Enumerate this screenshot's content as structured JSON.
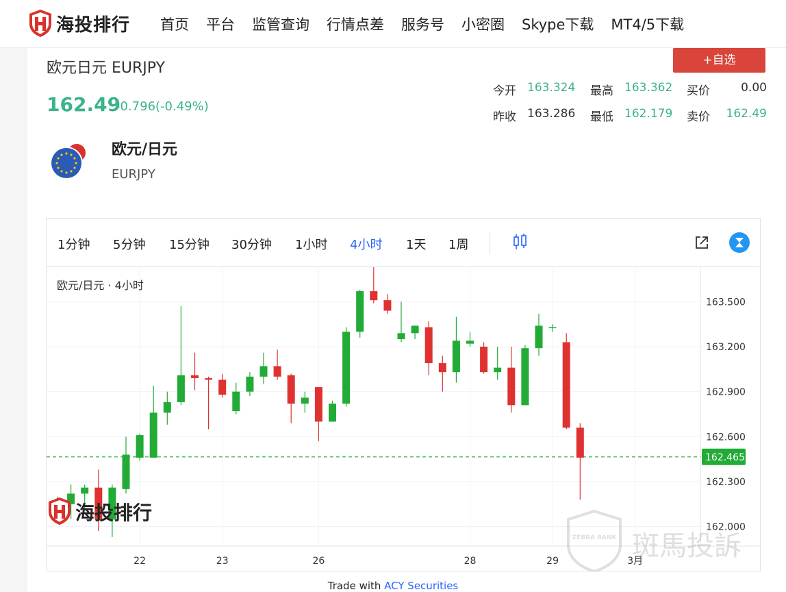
{
  "brand": {
    "name": "海投排行"
  },
  "nav": [
    "首页",
    "平台",
    "监管查询",
    "行情点差",
    "服务号",
    "小密圈",
    "Skype下载",
    "MT4/5下载"
  ],
  "symbol": {
    "title": "欧元日元 EURJPY",
    "fav_label": "+自选",
    "price": "162.49",
    "change": "-0.796(-0.49%)",
    "pair_name": "欧元/日元",
    "pair_code": "EURJPY"
  },
  "stats": {
    "open_label": "今开",
    "open": "163.324",
    "high_label": "最高",
    "high": "163.362",
    "bid_label": "买价",
    "bid": "0.00",
    "prev_label": "昨收",
    "prev": "163.286",
    "low_label": "最低",
    "low": "162.179",
    "ask_label": "卖价",
    "ask": "162.49"
  },
  "toolbar": {
    "timeframes": [
      "1分钟",
      "5分钟",
      "15分钟",
      "30分钟",
      "1小时",
      "4小时",
      "1天",
      "1周"
    ],
    "active": "4小时"
  },
  "chart_legend": "欧元/日元 · 4小时",
  "watermark": {
    "brand": "海投排行",
    "zebra": "斑馬投訴",
    "zebra_badge": "ZEBRA RANK"
  },
  "footer": {
    "prefix": "Trade with ",
    "link": "ACY Securities"
  },
  "colors": {
    "up": "#22ab36",
    "down": "#e03131",
    "accent": "#2962ff",
    "price_green": "#3bb38c",
    "fav_red": "#d9453a"
  },
  "chart_data": {
    "type": "candlestick",
    "title": "欧元/日元 · 4小时",
    "xticks": [
      {
        "label": "22",
        "index": 6
      },
      {
        "label": "23",
        "index": 12
      },
      {
        "label": "26",
        "index": 19
      },
      {
        "label": "28",
        "index": 30
      },
      {
        "label": "29",
        "index": 36
      },
      {
        "label": "3月",
        "index": 42
      }
    ],
    "yticks": [
      162.0,
      162.3,
      162.6,
      162.9,
      163.2,
      163.5
    ],
    "ylim": [
      161.87,
      163.73
    ],
    "last_price": 162.465,
    "candles": [
      {
        "o": 162.1,
        "h": 162.2,
        "l": 162.08,
        "c": 162.15
      },
      {
        "o": 162.15,
        "h": 162.28,
        "l": 162.05,
        "c": 162.22
      },
      {
        "o": 162.22,
        "h": 162.28,
        "l": 162.12,
        "c": 162.26
      },
      {
        "o": 162.26,
        "h": 162.38,
        "l": 161.97,
        "c": 162.05
      },
      {
        "o": 162.05,
        "h": 162.28,
        "l": 161.93,
        "c": 162.26
      },
      {
        "o": 162.25,
        "h": 162.6,
        "l": 162.22,
        "c": 162.48
      },
      {
        "o": 162.46,
        "h": 162.62,
        "l": 162.44,
        "c": 162.61
      },
      {
        "o": 162.46,
        "h": 162.94,
        "l": 162.46,
        "c": 162.76
      },
      {
        "o": 162.76,
        "h": 162.9,
        "l": 162.68,
        "c": 162.83
      },
      {
        "o": 162.83,
        "h": 163.47,
        "l": 162.81,
        "c": 163.01
      },
      {
        "o": 163.01,
        "h": 163.16,
        "l": 162.91,
        "c": 162.99
      },
      {
        "o": 162.99,
        "h": 163.0,
        "l": 162.65,
        "c": 162.98
      },
      {
        "o": 162.98,
        "h": 163.02,
        "l": 162.86,
        "c": 162.88
      },
      {
        "o": 162.77,
        "h": 162.96,
        "l": 162.75,
        "c": 162.9
      },
      {
        "o": 162.9,
        "h": 163.03,
        "l": 162.87,
        "c": 163.0
      },
      {
        "o": 163.0,
        "h": 163.16,
        "l": 162.95,
        "c": 163.07
      },
      {
        "o": 163.07,
        "h": 163.18,
        "l": 162.98,
        "c": 163.0
      },
      {
        "o": 163.01,
        "h": 163.02,
        "l": 162.69,
        "c": 162.82
      },
      {
        "o": 162.82,
        "h": 162.9,
        "l": 162.76,
        "c": 162.86
      },
      {
        "o": 162.93,
        "h": 162.93,
        "l": 162.57,
        "c": 162.7
      },
      {
        "o": 162.7,
        "h": 162.84,
        "l": 162.7,
        "c": 162.82
      },
      {
        "o": 162.82,
        "h": 163.33,
        "l": 162.8,
        "c": 163.3
      },
      {
        "o": 163.3,
        "h": 163.58,
        "l": 163.26,
        "c": 163.57
      },
      {
        "o": 163.57,
        "h": 163.73,
        "l": 163.49,
        "c": 163.51
      },
      {
        "o": 163.51,
        "h": 163.55,
        "l": 163.42,
        "c": 163.44
      },
      {
        "o": 163.25,
        "h": 163.5,
        "l": 163.23,
        "c": 163.29
      },
      {
        "o": 163.29,
        "h": 163.34,
        "l": 163.25,
        "c": 163.34
      },
      {
        "o": 163.33,
        "h": 163.37,
        "l": 163.01,
        "c": 163.09
      },
      {
        "o": 163.09,
        "h": 163.14,
        "l": 162.9,
        "c": 163.03
      },
      {
        "o": 163.03,
        "h": 163.4,
        "l": 162.96,
        "c": 163.24
      },
      {
        "o": 163.22,
        "h": 163.3,
        "l": 163.2,
        "c": 163.24
      },
      {
        "o": 163.2,
        "h": 163.23,
        "l": 163.02,
        "c": 163.03
      },
      {
        "o": 163.03,
        "h": 163.2,
        "l": 162.98,
        "c": 163.06
      },
      {
        "o": 163.06,
        "h": 163.2,
        "l": 162.76,
        "c": 162.81
      },
      {
        "o": 162.81,
        "h": 163.21,
        "l": 162.81,
        "c": 163.19
      },
      {
        "o": 163.19,
        "h": 163.42,
        "l": 163.14,
        "c": 163.34
      },
      {
        "o": 163.33,
        "h": 163.35,
        "l": 163.3,
        "c": 163.33
      },
      {
        "o": 163.23,
        "h": 163.29,
        "l": 162.65,
        "c": 162.66
      },
      {
        "o": 162.66,
        "h": 162.69,
        "l": 162.18,
        "c": 162.46
      }
    ]
  }
}
